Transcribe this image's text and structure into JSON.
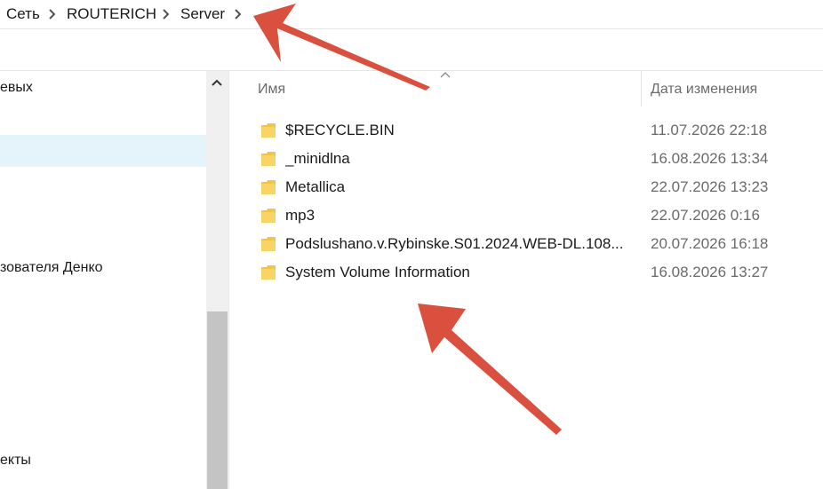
{
  "breadcrumb": [
    "Сеть",
    "ROUTERICH",
    "Server"
  ],
  "nav": {
    "items": [
      "евых",
      "зователя Денко",
      "екты"
    ]
  },
  "columns": {
    "name": "Имя",
    "date": "Дата изменения"
  },
  "files": [
    {
      "name": "$RECYCLE.BIN",
      "date": "11.07.2026 22:18"
    },
    {
      "name": "_minidlna",
      "date": "16.08.2026 13:34"
    },
    {
      "name": "Metallica",
      "date": "22.07.2026 13:23"
    },
    {
      "name": "mp3",
      "date": "22.07.2026 0:16"
    },
    {
      "name": "Podslushano.v.Rybinske.S01.2024.WEB-DL.108...",
      "date": "20.07.2026 16:18"
    },
    {
      "name": "System Volume Information",
      "date": "16.08.2026 13:27"
    }
  ],
  "colors": {
    "folder": "#f4c542",
    "annotation_arrow": "#d9503f",
    "selection": "#e5f3fb"
  },
  "icons": [
    "chevron-right-icon",
    "chevron-up-icon",
    "sort-up-icon",
    "folder-icon",
    "annotation-arrow"
  ]
}
